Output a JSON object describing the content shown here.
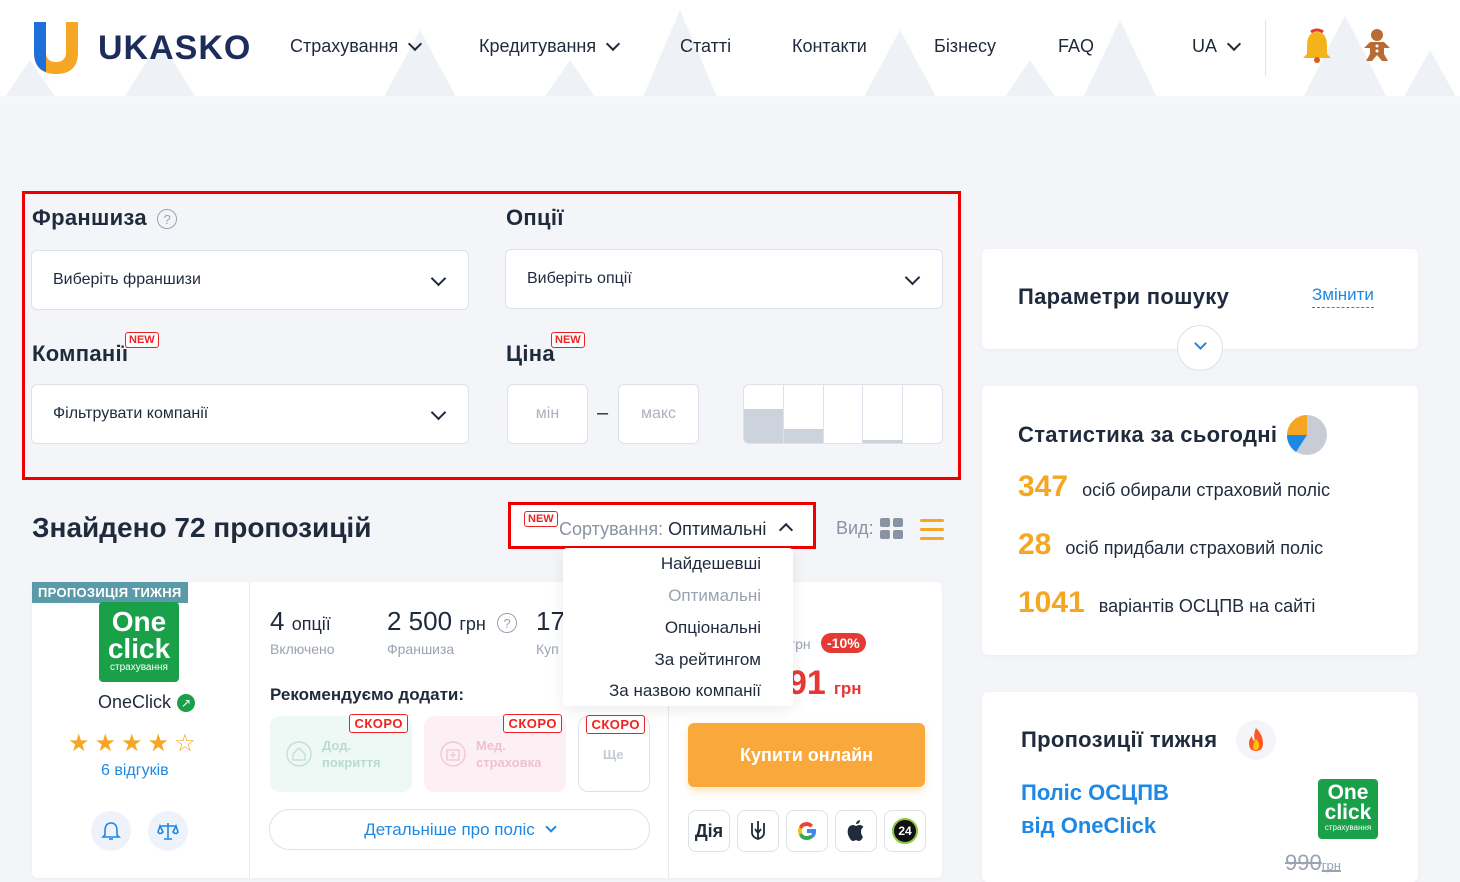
{
  "header": {
    "logo_text": "UKASKO",
    "nav": [
      {
        "label": "Страхування",
        "has_dropdown": true
      },
      {
        "label": "Кредитування",
        "has_dropdown": true
      },
      {
        "label": "Статті",
        "has_dropdown": false
      },
      {
        "label": "Контакти",
        "has_dropdown": false
      },
      {
        "label": "Бізнесу",
        "has_dropdown": false
      },
      {
        "label": "FAQ",
        "has_dropdown": false
      }
    ],
    "language": "UA"
  },
  "filters": {
    "franchise_label": "Франшиза",
    "franchise_placeholder": "Виберіть франшизи",
    "options_label": "Опції",
    "options_placeholder": "Виберіть опції",
    "companies_label": "Компанії",
    "companies_placeholder": "Фільтрувати компанії",
    "price_label": "Ціна",
    "price_min_placeholder": "мін",
    "price_max_placeholder": "макс",
    "price_dash": "–",
    "new_badge": "NEW"
  },
  "results": {
    "found_text": "Знайдено 72 пропозицій",
    "sort_prefix": "Сортування:",
    "sort_value": "Оптимальні",
    "view_label": "Вид:",
    "sort_options": [
      "Найдешевші",
      "Оптимальні",
      "Опціональні",
      "За рейтингом",
      "За назвою компанії"
    ]
  },
  "offer": {
    "week_badge": "ПРОПОЗИЦІЯ ТИЖНЯ",
    "logo_line1": "One",
    "logo_line2": "click",
    "logo_line3": "страхування",
    "company": "OneClick",
    "rating_stars": "★★★★☆",
    "reviews": "6 відгуків",
    "options_value": "4",
    "options_unit": "опції",
    "options_key": "Включено",
    "franchise_value": "2 500",
    "franchise_unit": "грн",
    "franchise_key": "Франшиза",
    "third_value": "17",
    "third_key": "Куп",
    "recommend_title": "Рекомендуємо додати:",
    "addons": [
      {
        "label": "Дод. покриття",
        "badge": "СКОРО"
      },
      {
        "label": "Мед. страховка",
        "badge": "СКОРО"
      },
      {
        "label": "Ще",
        "badge": "СКОРО"
      }
    ],
    "details_btn": "Детальніше про поліс",
    "old_price_unit": "грн",
    "discount": "-10%",
    "price_partial": "91",
    "price_unit": "грн",
    "buy_btn": "Купити онлайн",
    "pay_methods": [
      "Дія",
      "trident",
      "google",
      "apple",
      "24"
    ]
  },
  "sidebar": {
    "search_title": "Параметри пошуку",
    "change_link": "Змінити",
    "stats_title": "Статистика за сьогодні",
    "stats": [
      {
        "value": "347",
        "text": "осіб обирали страховий поліс"
      },
      {
        "value": "28",
        "text": "осіб придбали страховий поліс"
      },
      {
        "value": "1041",
        "text": "варіантів ОСЦПВ на сайті"
      }
    ],
    "week_title": "Пропозиції тижня",
    "week_offer_line1": "Поліс ОСЦПВ",
    "week_offer_line2": "від OneClick",
    "week_old_price": "990",
    "week_old_price_unit": "грн"
  },
  "colors": {
    "accent_orange": "#f5a623",
    "link_blue": "#1e88e5",
    "highlight_red": "#e00000",
    "brand_green": "#1ba04a"
  }
}
